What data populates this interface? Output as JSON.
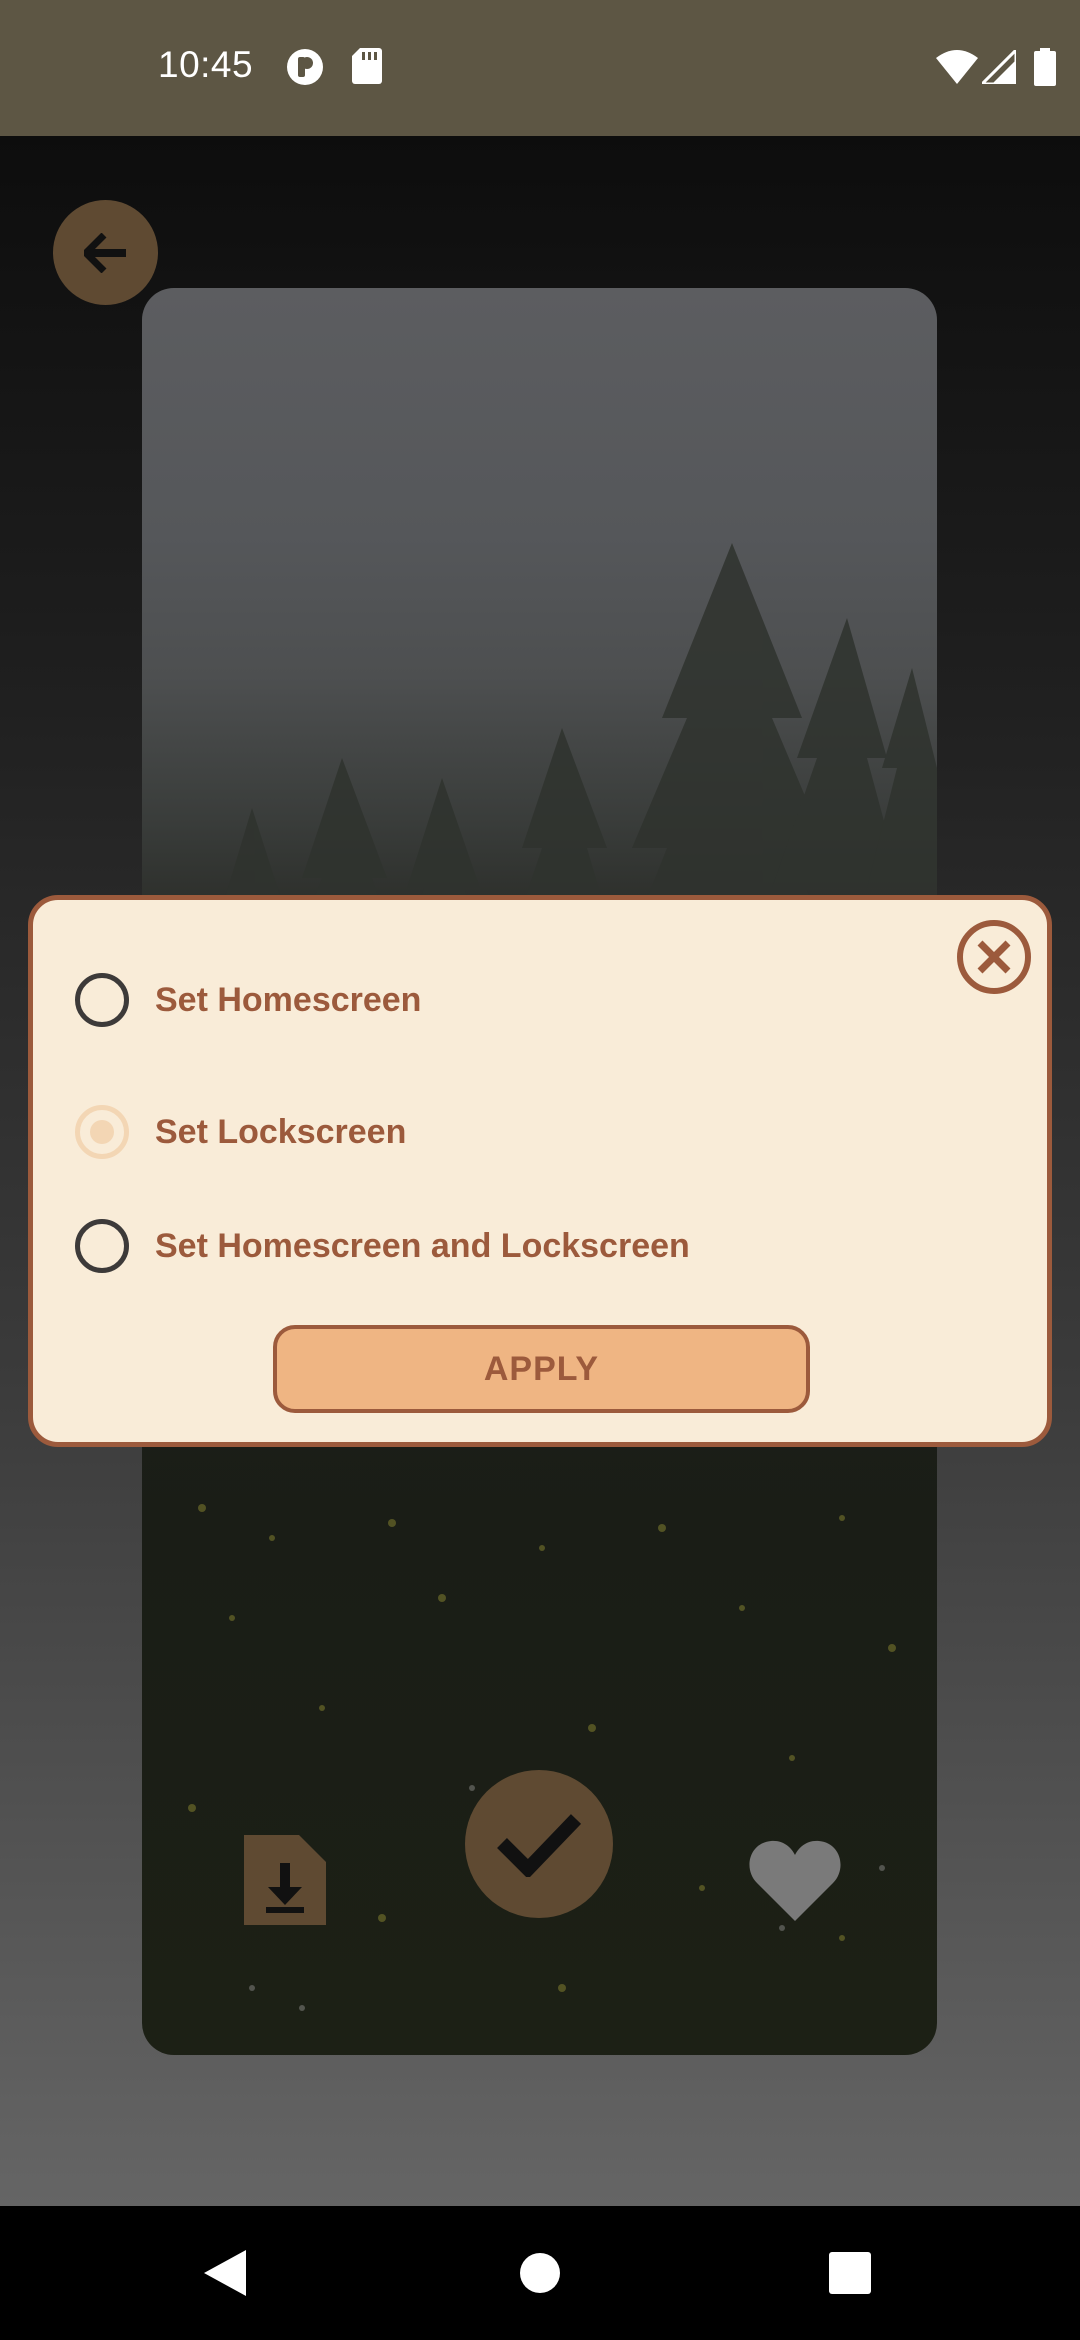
{
  "status_bar": {
    "time": "10:45",
    "left_icons": [
      "do-not-disturb-icon",
      "sd-card-icon"
    ],
    "right_icons": [
      "wifi-icon",
      "cell-signal-icon",
      "battery-icon"
    ]
  },
  "preview": {
    "back_icon": "arrow-left-icon",
    "actions": [
      {
        "name": "download-icon"
      },
      {
        "name": "check-icon"
      },
      {
        "name": "heart-icon"
      }
    ]
  },
  "dialog": {
    "close_icon": "close-circle-icon",
    "options": [
      {
        "label": "Set Homescreen",
        "selected": false
      },
      {
        "label": "Set Lockscreen",
        "selected": true
      },
      {
        "label": "Set Homescreen and Lockscreen",
        "selected": false
      }
    ],
    "apply_label": "APPLY"
  },
  "colors": {
    "accent_brown": "#9c5a3c",
    "dialog_bg": "#f9ecd8",
    "button_bg": "#efb583",
    "status_bar_bg": "#5d5644",
    "fab_bg": "#5f4a32"
  },
  "nav_bar": {
    "icons": [
      "nav-back-icon",
      "nav-home-icon",
      "nav-recents-icon"
    ]
  }
}
